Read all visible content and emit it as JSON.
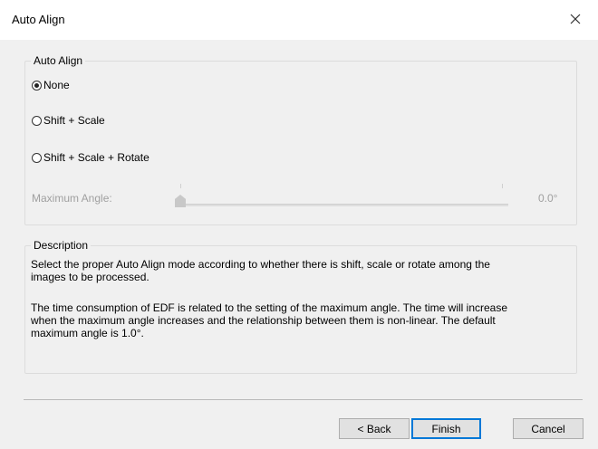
{
  "window": {
    "title": "Auto Align"
  },
  "icons": {
    "close": "close-icon"
  },
  "auto_align_group": {
    "label": "Auto Align",
    "options": [
      {
        "label": "None",
        "selected": true
      },
      {
        "label": "Shift + Scale",
        "selected": false
      },
      {
        "label": "Shift + Scale + Rotate",
        "selected": false
      }
    ],
    "max_angle": {
      "label": "Maximum Angle:",
      "value": "0.0°",
      "slider_fraction": 0.0,
      "enabled": false
    }
  },
  "description_group": {
    "label": "Description",
    "para1_line1": "Select the proper Auto Align mode according to whether there is shift, scale or rotate among the",
    "para1_line2": "images to be processed.",
    "para2_line1": "The time consumption of EDF is related to the setting of the maximum angle. The time will increase",
    "para2_line2": "when the maximum angle increases and the relationship between them is non-linear. The default",
    "para2_line3": "maximum angle is 1.0°."
  },
  "buttons": {
    "back": "< Back",
    "finish": "Finish",
    "cancel": "Cancel"
  },
  "colors": {
    "accent": "#0078d7",
    "dialog_bg": "#f0f0f0",
    "disabled_text": "#a0a0a0"
  }
}
